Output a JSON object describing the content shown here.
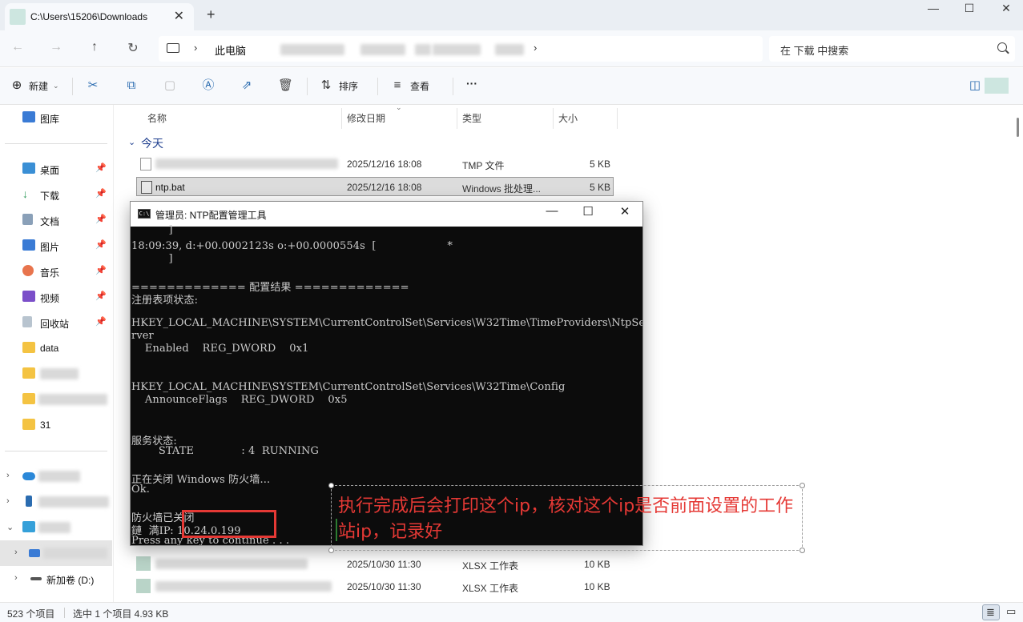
{
  "window": {
    "tab_title": "C:\\Users\\15206\\Downloads",
    "tab_close": "✕",
    "new_tab": "+",
    "minimize": "—",
    "maximize": "☐",
    "close": "✕"
  },
  "address": {
    "this_pc": "此电脑",
    "search_placeholder": "在 下载 中搜索"
  },
  "toolbar": {
    "new_label": "新建",
    "sort_label": "排序",
    "view_label": "查看",
    "more": "···"
  },
  "sidebar": {
    "gallery": "图库",
    "quick": [
      {
        "label": "桌面"
      },
      {
        "label": "下载"
      },
      {
        "label": "文档"
      },
      {
        "label": "图片"
      },
      {
        "label": "音乐"
      },
      {
        "label": "视频"
      },
      {
        "label": "回收站"
      }
    ],
    "folders": [
      {
        "label": "data"
      },
      {
        "label": "31"
      }
    ],
    "drive_d": "新加卷 (D:)"
  },
  "filelist": {
    "columns": [
      "名称",
      "修改日期",
      "类型",
      "大小"
    ],
    "group_today": "今天",
    "rows": [
      {
        "name": "",
        "date": "2025/12/16 18:08",
        "type": "TMP 文件",
        "size": "5 KB"
      },
      {
        "name": "ntp.bat",
        "date": "2025/12/16 18:08",
        "type": "Windows 批处理...",
        "size": "5 KB"
      },
      {
        "name": "",
        "date": "2025/10/30 11:30",
        "type": "XLSX 工作表",
        "size": "10 KB"
      },
      {
        "name": "",
        "date": "2025/10/30 11:30",
        "type": "XLSX 工作表",
        "size": "10 KB"
      }
    ]
  },
  "status": {
    "count": "523 个项目",
    "selected": "选中 1 个项目  4.93 KB"
  },
  "console": {
    "title": "管理员: NTP配置管理工具",
    "lines": [
      "           ]",
      "18:09:39, d:+00.0002123s o:+00.0000554s  [                     *",
      "           ]",
      "",
      "============= 配置结果 =============",
      "注册表项状态:",
      "",
      "HKEY_LOCAL_MACHINE\\SYSTEM\\CurrentControlSet\\Services\\W32Time\\TimeProviders\\NtpSe",
      "rver",
      "    Enabled    REG_DWORD    0x1",
      "",
      "",
      "HKEY_LOCAL_MACHINE\\SYSTEM\\CurrentControlSet\\Services\\W32Time\\Config",
      "    AnnounceFlags    REG_DWORD    0x5",
      "",
      "",
      "服务状态:",
      "        STATE              : 4  RUNNING",
      "",
      "正在关闭 Windows 防火墙...",
      "Ok.",
      "",
      "防火墙已关闭",
      "鏈  満IP: 10.24.0.199",
      "Press any key to continue . . ."
    ]
  },
  "annotation": {
    "text": "执行完成后会打印这个ip，核对这个ip是否前面设置的工作站ip，记录好",
    "color": "#e53935"
  }
}
